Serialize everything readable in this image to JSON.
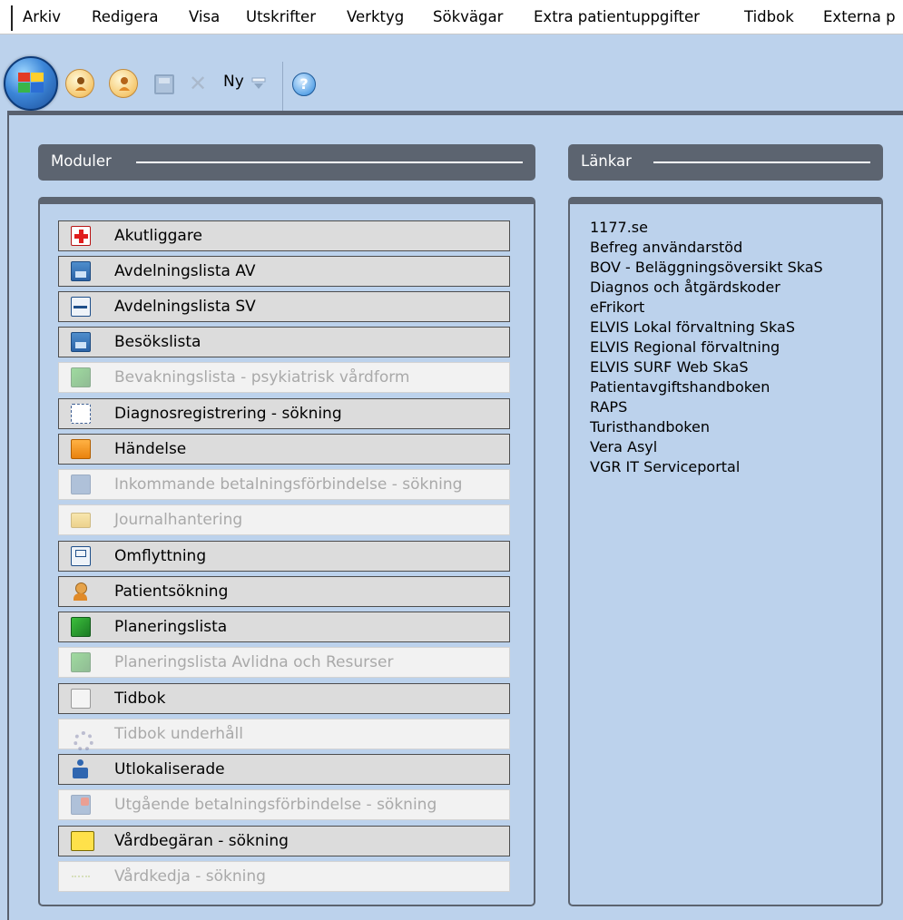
{
  "menu": [
    "Arkiv",
    "Redigera",
    "Visa",
    "Utskrifter",
    "Verktyg",
    "Sökvägar",
    "Extra patientuppgifter",
    "Tidbok",
    "Externa p"
  ],
  "toolbar": {
    "new_label": "Ny",
    "help_glyph": "?",
    "icons": [
      "puzzle-orb-icon",
      "patient-search-icon",
      "patient-icon",
      "save-icon",
      "delete-icon",
      "dropdown-arrow-icon",
      "help-icon"
    ]
  },
  "modules": {
    "header": "Moduler",
    "items": [
      {
        "label": "Akutliggare",
        "enabled": true,
        "icon": "red-cross-icon"
      },
      {
        "label": "Avdelningslista AV",
        "enabled": true,
        "icon": "ward-board-icon"
      },
      {
        "label": "Avdelningslista SV",
        "enabled": true,
        "icon": "bed-icon"
      },
      {
        "label": "Besökslista",
        "enabled": true,
        "icon": "visit-board-icon"
      },
      {
        "label": "Bevakningslista - psykiatrisk vårdform",
        "enabled": false,
        "icon": "green-book-icon"
      },
      {
        "label": "Diagnosregistrering - sökning",
        "enabled": true,
        "icon": "diagnosis-code-icon"
      },
      {
        "label": "Händelse",
        "enabled": true,
        "icon": "event-bag-icon"
      },
      {
        "label": "Inkommande betalningsförbindelse - sökning",
        "enabled": false,
        "icon": "incoming-bf-icon"
      },
      {
        "label": "Journalhantering",
        "enabled": false,
        "icon": "folder-icon"
      },
      {
        "label": "Omflyttning",
        "enabled": true,
        "icon": "relocation-icon"
      },
      {
        "label": "Patientsökning",
        "enabled": true,
        "icon": "patient-search-icon"
      },
      {
        "label": "Planeringslista",
        "enabled": true,
        "icon": "green-book-icon"
      },
      {
        "label": "Planeringslista Avlidna och Resurser",
        "enabled": false,
        "icon": "green-book-icon"
      },
      {
        "label": "Tidbok",
        "enabled": true,
        "icon": "calendar-icon"
      },
      {
        "label": "Tidbok underhåll",
        "enabled": false,
        "icon": "calendar-gear-icon"
      },
      {
        "label": "Utlokaliserade",
        "enabled": true,
        "icon": "user-desk-icon"
      },
      {
        "label": "Utgående betalningsförbindelse - sökning",
        "enabled": false,
        "icon": "outgoing-bf-icon"
      },
      {
        "label": "Vårdbegäran - sökning",
        "enabled": true,
        "icon": "vb-icon"
      },
      {
        "label": "Vårdkedja - sökning",
        "enabled": false,
        "icon": "chain-icon"
      }
    ]
  },
  "links": {
    "header": "Länkar",
    "items": [
      "1177.se",
      "Befreg användarstöd",
      "BOV - Beläggningsöversikt SkaS",
      "Diagnos och åtgärdskoder",
      "eFrikort",
      "ELVIS Lokal förvaltning SkaS",
      "ELVIS Regional förvaltning",
      "ELVIS SURF Web SkaS",
      "Patientavgiftshandboken",
      "RAPS",
      "Turisthandboken",
      "Vera Asyl",
      "VGR IT Serviceportal"
    ]
  },
  "colors": {
    "background": "#bcd2ec",
    "header_bar": "#5c6470",
    "button_face": "#dcdcdc",
    "disabled_text": "#a9a9a9"
  }
}
